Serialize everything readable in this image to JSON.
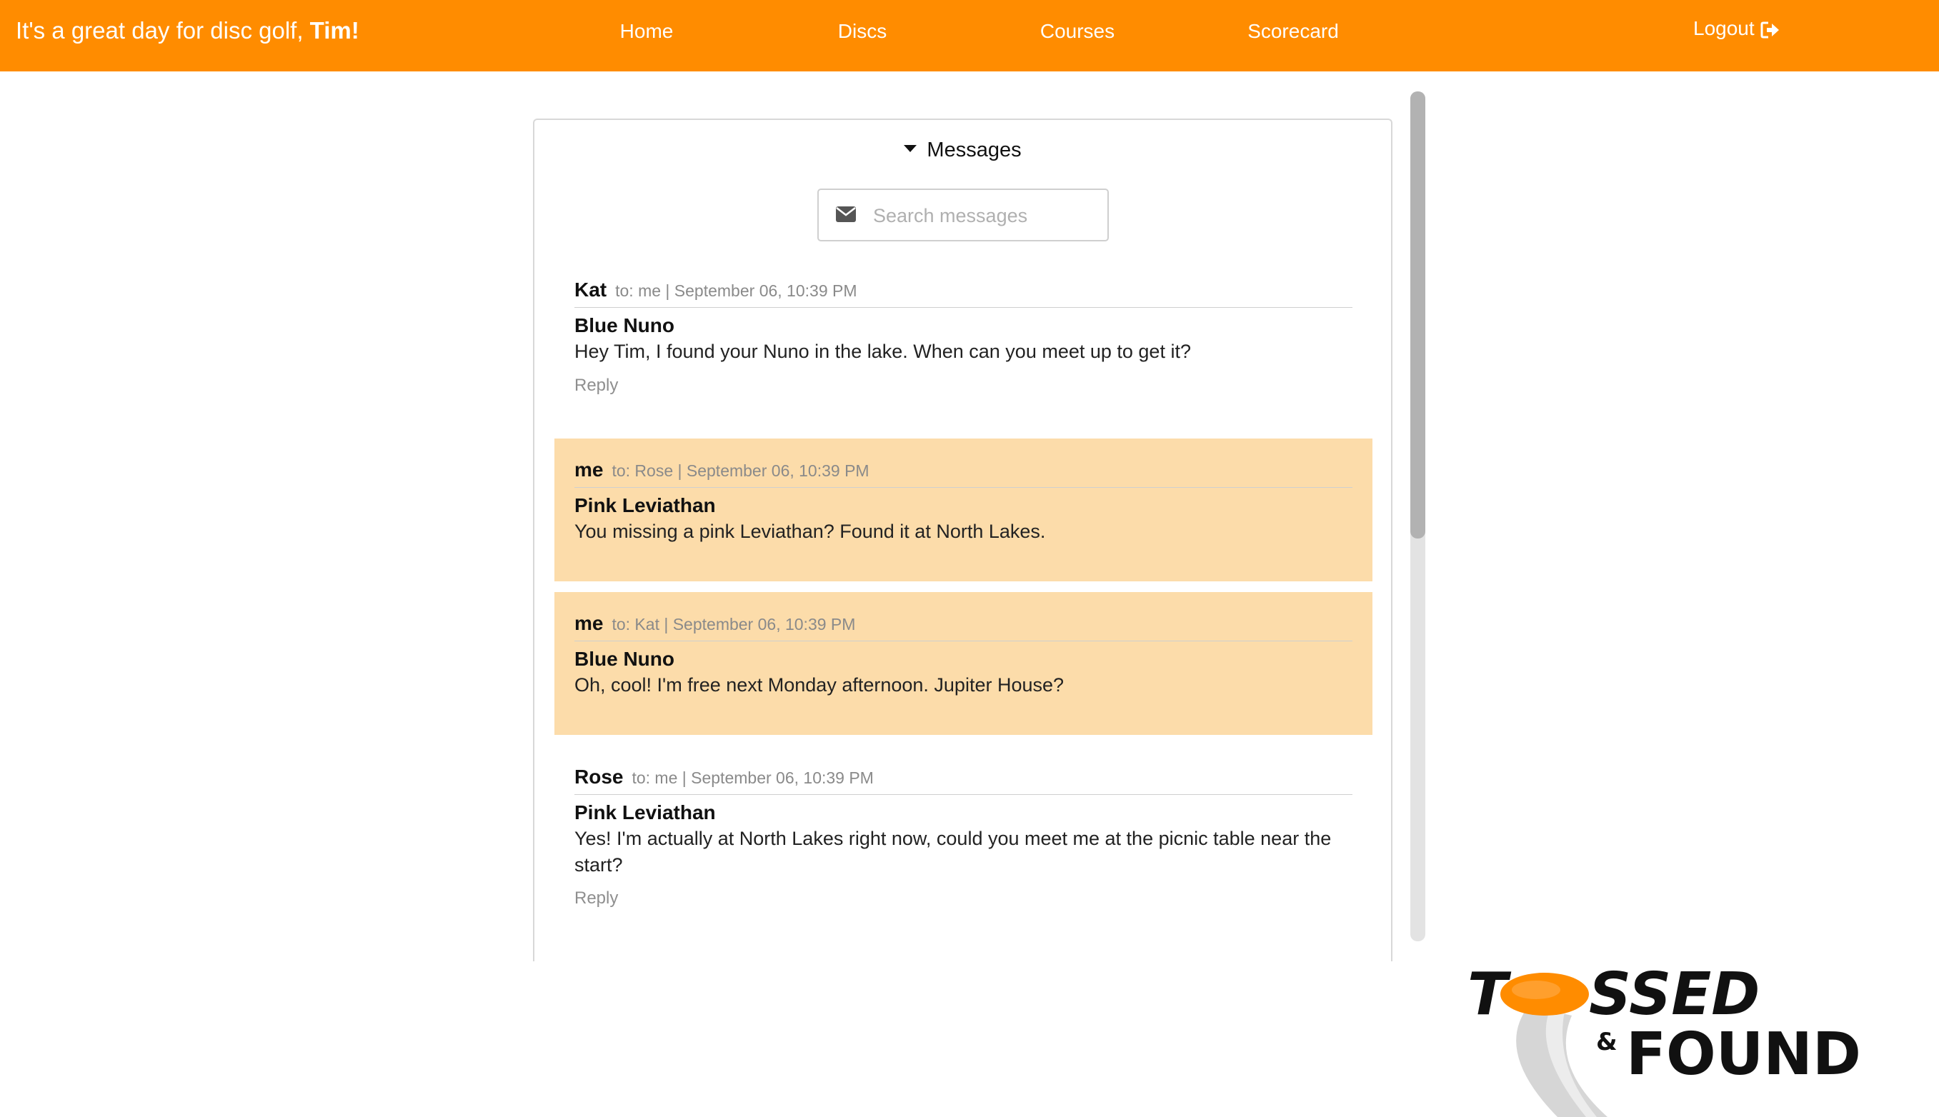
{
  "header": {
    "greeting_prefix": "It's a great day for disc golf, ",
    "user_name": "Tim!",
    "nav": [
      {
        "label": "Home"
      },
      {
        "label": "Discs"
      },
      {
        "label": "Courses"
      },
      {
        "label": "Scorecard"
      }
    ],
    "logout_label": "Logout",
    "logout_icon": "sign-out-icon"
  },
  "messages_panel": {
    "title": "Messages",
    "toggle_icon": "caret-down-icon",
    "search": {
      "placeholder": "Search messages",
      "value": "",
      "icon": "envelope-icon"
    },
    "items": [
      {
        "sender": "Kat",
        "meta": "to: me | September 06, 10:39 PM",
        "subject": "Blue Nuno",
        "body": "Hey Tim, I found your Nuno in the lake. When can you meet up to get it?",
        "reply_label": "Reply",
        "is_sent": false
      },
      {
        "sender": "me",
        "meta": "to: Rose | September 06, 10:39 PM",
        "subject": "Pink Leviathan",
        "body": "You missing a pink Leviathan? Found it at North Lakes.",
        "is_sent": true
      },
      {
        "sender": "me",
        "meta": "to: Kat | September 06, 10:39 PM",
        "subject": "Blue Nuno",
        "body": "Oh, cool! I'm free next Monday afternoon. Jupiter House?",
        "is_sent": true
      },
      {
        "sender": "Rose",
        "meta": "to: me | September 06, 10:39 PM",
        "subject": "Pink Leviathan",
        "body": "Yes! I'm actually at North Lakes right now, could you meet me at the picnic table near the start?",
        "reply_label": "Reply",
        "is_sent": false
      }
    ]
  },
  "logo": {
    "line1": "TOSSED",
    "amp": "&",
    "line2": "FOUND"
  },
  "colors": {
    "brand_orange": "#ff8c00",
    "sent_message_bg": "#fcdcaa",
    "meta_gray": "#8a8a8a"
  }
}
